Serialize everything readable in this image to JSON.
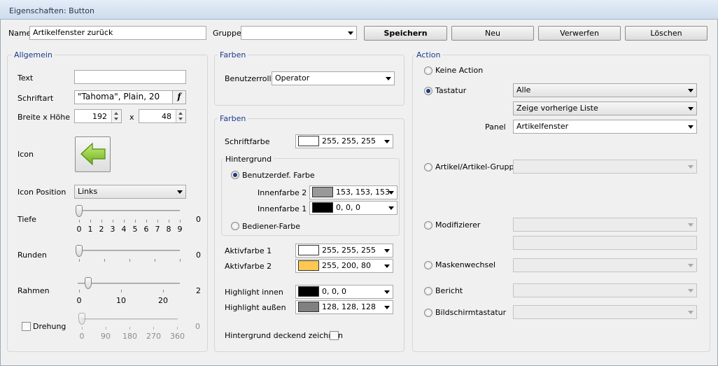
{
  "window": {
    "title": "Eigenschaften: Button"
  },
  "toolbar": {
    "name_label": "Name",
    "name_value": "Artikelfenster zurück",
    "gruppe_label": "Gruppe",
    "gruppe_value": "",
    "save": "Speichern",
    "new": "Neu",
    "discard": "Verwerfen",
    "delete": "Löschen"
  },
  "general": {
    "legend": "Allgemein",
    "text_label": "Text",
    "text_value": "",
    "font_label": "Schriftart",
    "font_value": "\"Tahoma\", Plain, 20",
    "font_button": "f",
    "size_label": "Breite x Höhe",
    "width_value": "192",
    "size_sep": "x",
    "height_value": "48",
    "icon_label": "Icon",
    "icon_name": "green-left-arrow-icon",
    "icon_position_label": "Icon Position",
    "icon_position_value": "Links",
    "depth": {
      "label": "Tiefe",
      "value": "0",
      "ticks": [
        "0",
        "1",
        "2",
        "3",
        "4",
        "5",
        "6",
        "7",
        "8",
        "9"
      ]
    },
    "round": {
      "label": "Runden",
      "value": "0"
    },
    "frame": {
      "label": "Rahmen",
      "value": "2",
      "ticks": [
        "0",
        "10",
        "20"
      ]
    },
    "rotation": {
      "label": "Drehung",
      "value": "0",
      "ticks": [
        "0",
        "90",
        "180",
        "270",
        "360"
      ],
      "checked": false
    }
  },
  "colors1": {
    "legend": "Farben",
    "role_label": "Benutzerrolle",
    "role_value": "Operator"
  },
  "colors2": {
    "legend": "Farben",
    "font_color_label": "Schriftfarbe",
    "font_color_value": "255, 255, 255",
    "font_color_hex": "#ffffff",
    "background_legend": "Hintergrund",
    "custom_color_label": "Benutzerdef. Farbe",
    "inner2_label": "Innenfarbe 2",
    "inner2_value": "153, 153, 153",
    "inner2_hex": "#999999",
    "inner1_label": "Innenfarbe 1",
    "inner1_value": "0, 0, 0",
    "inner1_hex": "#000000",
    "operator_color_label": "Bediener-Farbe",
    "active1_label": "Aktivfarbe 1",
    "active1_value": "255, 255, 255",
    "active1_hex": "#ffffff",
    "active2_label": "Aktivfarbe 2",
    "active2_value": "255, 200, 80",
    "active2_hex": "#ffc850",
    "hl_inner_label": "Highlight innen",
    "hl_inner_value": "0, 0, 0",
    "hl_inner_hex": "#000000",
    "hl_outer_label": "Highlight außen",
    "hl_outer_value": "128, 128, 128",
    "hl_outer_hex": "#808080",
    "opaque_label": "Hintergrund deckend zeichnen"
  },
  "action": {
    "legend": "Action",
    "none_label": "Keine Action",
    "keyboard_label": "Tastatur",
    "keyboard_value": "Alle",
    "keyboard_action_value": "Zeige vorherige Liste",
    "panel_label": "Panel",
    "panel_value": "Artikelfenster",
    "article_label": "Artikel/Artikel-Gruppe",
    "modifier_label": "Modifizierer",
    "mask_label": "Maskenwechsel",
    "report_label": "Bericht",
    "screenkb_label": "Bildschirmtastatur"
  }
}
